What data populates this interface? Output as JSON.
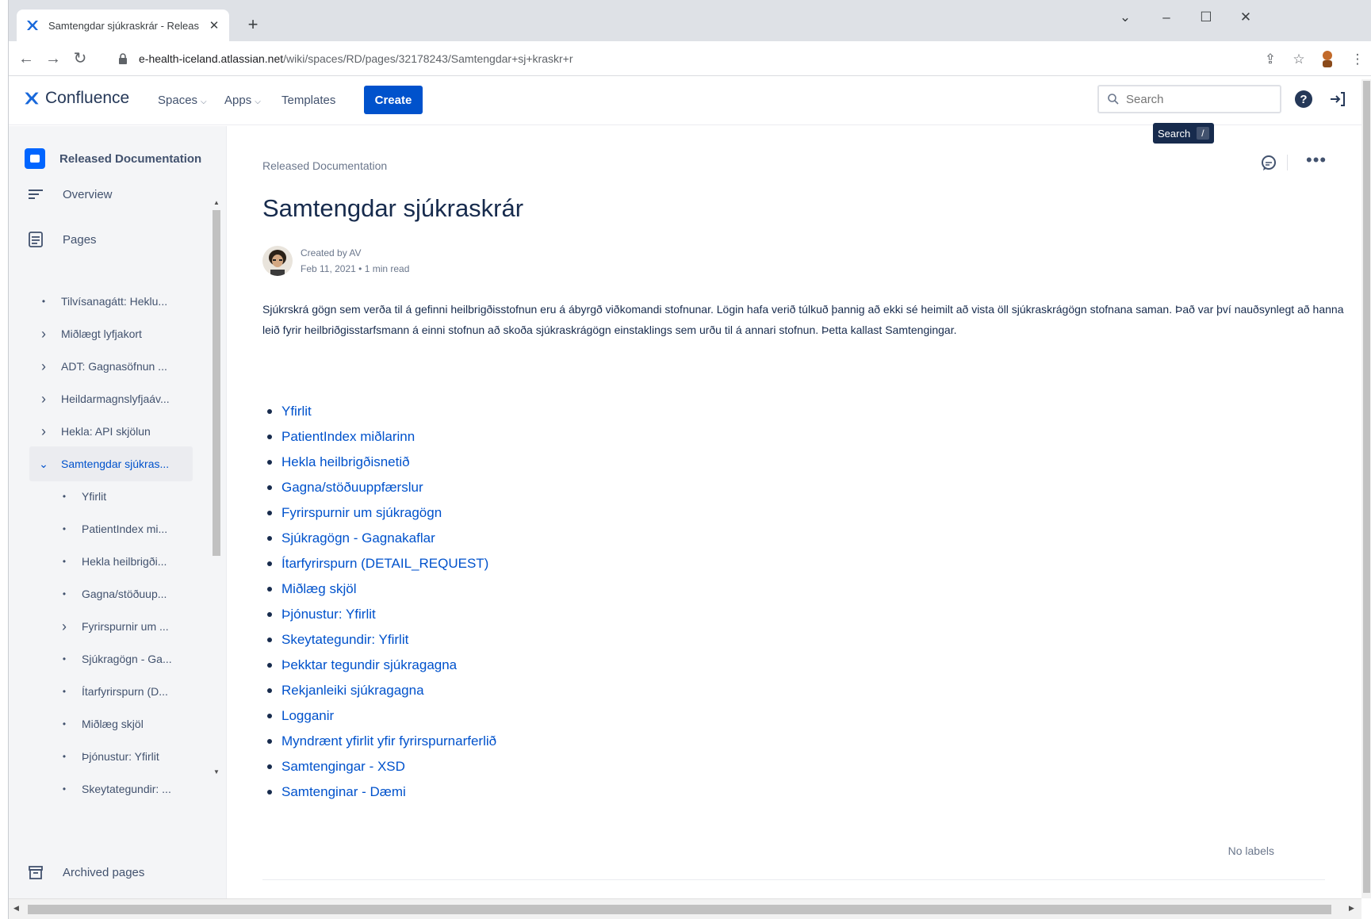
{
  "browser": {
    "tab_title": "Samtengdar sjúkraskrár - Releas",
    "url_host": "e-health-iceland.atlassian.net",
    "url_path": "/wiki/spaces/RD/pages/32178243/Samtengdar+sj+kraskr+r"
  },
  "header": {
    "logo_text": "Confluence",
    "nav": {
      "spaces": "Spaces",
      "apps": "Apps",
      "templates": "Templates"
    },
    "create_label": "Create",
    "search_placeholder": "Search",
    "tooltip_label": "Search",
    "tooltip_key": "/"
  },
  "sidebar": {
    "space_name": "Released Documentation",
    "overview": "Overview",
    "pages": "Pages",
    "tree": [
      {
        "label": "Tilvísanagátt: Heklu...",
        "marker": "dot",
        "level": 0
      },
      {
        "label": "Miðlægt lyfjakort",
        "marker": "chevron",
        "level": 0
      },
      {
        "label": "ADT: Gagnasöfnun ...",
        "marker": "chevron",
        "level": 0
      },
      {
        "label": "Heildarmagnslyfjaáv...",
        "marker": "chevron",
        "level": 0
      },
      {
        "label": "Hekla: API skjölun",
        "marker": "chevron",
        "level": 0
      },
      {
        "label": "Samtengdar sjúkras...",
        "marker": "expanded",
        "level": 0,
        "selected": true
      },
      {
        "label": "Yfirlit",
        "marker": "dot",
        "level": 1
      },
      {
        "label": "PatientIndex mi...",
        "marker": "dot",
        "level": 1
      },
      {
        "label": "Hekla heilbrigði...",
        "marker": "dot",
        "level": 1
      },
      {
        "label": "Gagna/stöðuup...",
        "marker": "dot",
        "level": 1
      },
      {
        "label": "Fyrirspurnir um ...",
        "marker": "chevron",
        "level": 1
      },
      {
        "label": "Sjúkragögn - Ga...",
        "marker": "dot",
        "level": 1
      },
      {
        "label": "Ítarfyrirspurn (D...",
        "marker": "dot",
        "level": 1
      },
      {
        "label": "Miðlæg skjöl",
        "marker": "dot",
        "level": 1
      },
      {
        "label": "Þjónustur: Yfirlit",
        "marker": "dot",
        "level": 1
      },
      {
        "label": "Skeytategundir: ...",
        "marker": "dot",
        "level": 1
      }
    ],
    "archived": "Archived pages"
  },
  "page": {
    "breadcrumb": "Released Documentation",
    "title": "Samtengdar sjúkraskrár",
    "created_by": "Created by AV",
    "date_line": "Feb 11, 2021 • 1 min read",
    "body": "Sjúkrskrá gögn sem verða til á gefinni heilbrigðisstofnun eru á ábyrgð viðkomandi stofnunar. Lögin hafa verið túlkuð þannig að ekki sé heimilt að vista öll sjúkraskrágögn stofnana saman. Það var því nauðsynlegt að hanna leið fyrir heilbriðgisstarfsmann á einni stofnun að skoða sjúkraskrágögn einstaklings sem urðu til á annari stofnun. Þetta kallast Samtengingar.",
    "links": [
      "Yfirlit",
      "PatientIndex miðlarinn",
      "Hekla heilbrigðisnetið",
      "Gagna/stöðuuppfærslur",
      "Fyrirspurnir um sjúkragögn",
      "Sjúkragögn - Gagnakaflar",
      "Ítarfyrirspurn (DETAIL_REQUEST)",
      "Miðlæg skjöl",
      "Þjónustur: Yfirlit",
      "Skeytategundir: Yfirlit",
      "Þekktar tegundir sjúkragagna",
      "Rekjanleiki sjúkragagna",
      "Logganir",
      "Myndrænt yfirlit yfir fyrirspurnarferlið",
      "Samtengingar - XSD",
      "Samtenginar - Dæmi"
    ],
    "no_labels": "No labels"
  },
  "colors": {
    "primary": "#0052cc",
    "text": "#172b4d",
    "subtle": "#42526e",
    "sidebar_bg": "#f4f5f7"
  }
}
